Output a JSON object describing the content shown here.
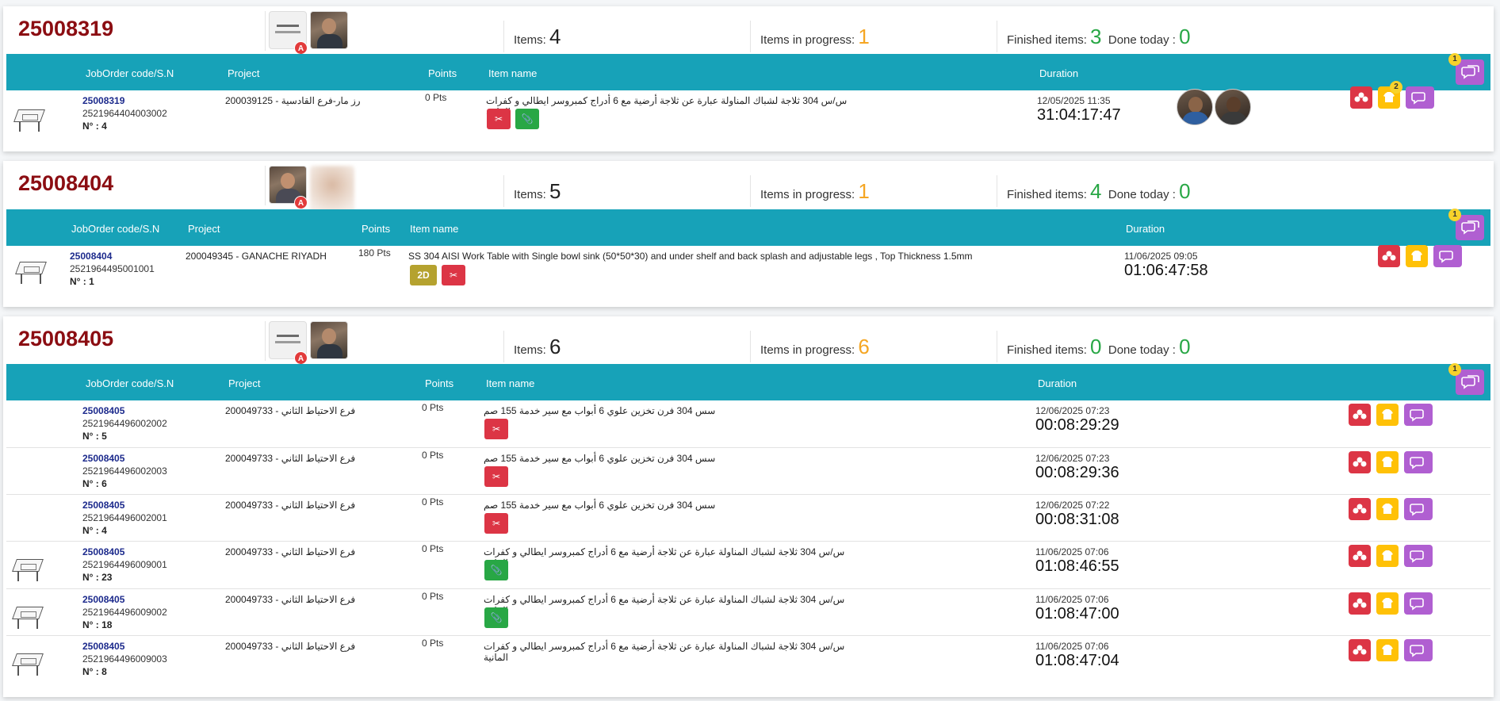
{
  "stat_labels": {
    "items": "Items:",
    "in_progress": "Items in progress:",
    "finished": "Finished items:",
    "done_today": "Done today :"
  },
  "table_head": {
    "code": "JobOrder code/S.N",
    "project": "Project",
    "points": "Points",
    "item": "Item name",
    "duration": "Duration"
  },
  "colors": {
    "teal": "#17a2b8",
    "job_red": "#8b0d12",
    "orange": "#f5a623",
    "green": "#28a745"
  },
  "avatar_badge": "A",
  "cards": [
    {
      "job_no": "25008319",
      "items": "4",
      "in_progress": "1",
      "finished": "3",
      "done_today": "0",
      "chat_count": "1",
      "rows": [
        {
          "code": "25008319",
          "sn": "2521964404003002",
          "nb": "N° : 4",
          "project": "رز مار-فرع القادسية - 200039125",
          "points": "0 Pts",
          "item": "س/س 304 ثلاجة لشباك المناولة عبارة عن ثلاجة أرضية مع 6 أدراج كمبروسر ايطالي و كفرات المانية",
          "date": "12/05/2025 11:35",
          "duration": "31:04:17:47",
          "badge": "2"
        }
      ]
    },
    {
      "job_no": "25008404",
      "items": "5",
      "in_progress": "1",
      "finished": "4",
      "done_today": "0",
      "chat_count": "1",
      "rows": [
        {
          "code": "25008404",
          "sn": "2521964495001001",
          "nb": "N° : 1",
          "project": "200049345 - GANACHE RIYADH",
          "points": "180 Pts",
          "item": "SS 304 AISI Work Table with Single bowl sink (50*50*30) and under shelf and back splash and adjustable legs , Top Thickness 1.5mm",
          "btn_2d": "2D",
          "date": "11/06/2025 09:05",
          "duration": "01:06:47:58"
        }
      ]
    },
    {
      "job_no": "25008405",
      "items": "6",
      "in_progress": "6",
      "finished": "0",
      "done_today": "0",
      "chat_count": "1",
      "rows": [
        {
          "code": "25008405",
          "sn": "2521964496002002",
          "nb": "N° : 5",
          "project": "فرع الاحتياط الثاني - 200049733",
          "points": "0 Pts",
          "item": "سس 304 فرن تخزين علوي 6 أبواب مع سير خدمة 155 صم",
          "date": "12/06/2025 07:23",
          "duration": "00:08:29:29"
        },
        {
          "code": "25008405",
          "sn": "2521964496002003",
          "nb": "N° : 6",
          "project": "فرع الاحتياط الثاني - 200049733",
          "points": "0 Pts",
          "item": "سس 304 فرن تخزين علوي 6 أبواب مع سير خدمة 155 صم",
          "date": "12/06/2025 07:23",
          "duration": "00:08:29:36"
        },
        {
          "code": "25008405",
          "sn": "2521964496002001",
          "nb": "N° : 4",
          "project": "فرع الاحتياط الثاني - 200049733",
          "points": "0 Pts",
          "item": "سس 304 فرن تخزين علوي 6 أبواب مع سير خدمة 155 صم",
          "date": "12/06/2025 07:22",
          "duration": "00:08:31:08"
        },
        {
          "code": "25008405",
          "sn": "2521964496009001",
          "nb": "N° : 23",
          "project": "فرع الاحتياط الثاني - 200049733",
          "points": "0 Pts",
          "item": "س/س 304 ثلاجة لشباك المناولة عبارة عن ثلاجة أرضية مع 6 أدراج كمبروسر ايطالي و كفرات المانية",
          "date": "11/06/2025 07:06",
          "duration": "01:08:46:55"
        },
        {
          "code": "25008405",
          "sn": "2521964496009002",
          "nb": "N° : 18",
          "project": "فرع الاحتياط الثاني - 200049733",
          "points": "0 Pts",
          "item": "س/س 304 ثلاجة لشباك المناولة عبارة عن ثلاجة أرضية مع 6 أدراج كمبروسر ايطالي و كفرات المانية",
          "date": "11/06/2025 07:06",
          "duration": "01:08:47:00"
        },
        {
          "code": "25008405",
          "sn": "2521964496009003",
          "nb": "N° : 8",
          "project": "فرع الاحتياط الثاني - 200049733",
          "points": "0 Pts",
          "item": "س/س 304 ثلاجة لشباك المناولة عبارة عن ثلاجة أرضية مع 6 أدراج كمبروسر ايطالي و كفرات المانية",
          "date": "11/06/2025 07:06",
          "duration": "01:08:47:04"
        }
      ]
    }
  ]
}
